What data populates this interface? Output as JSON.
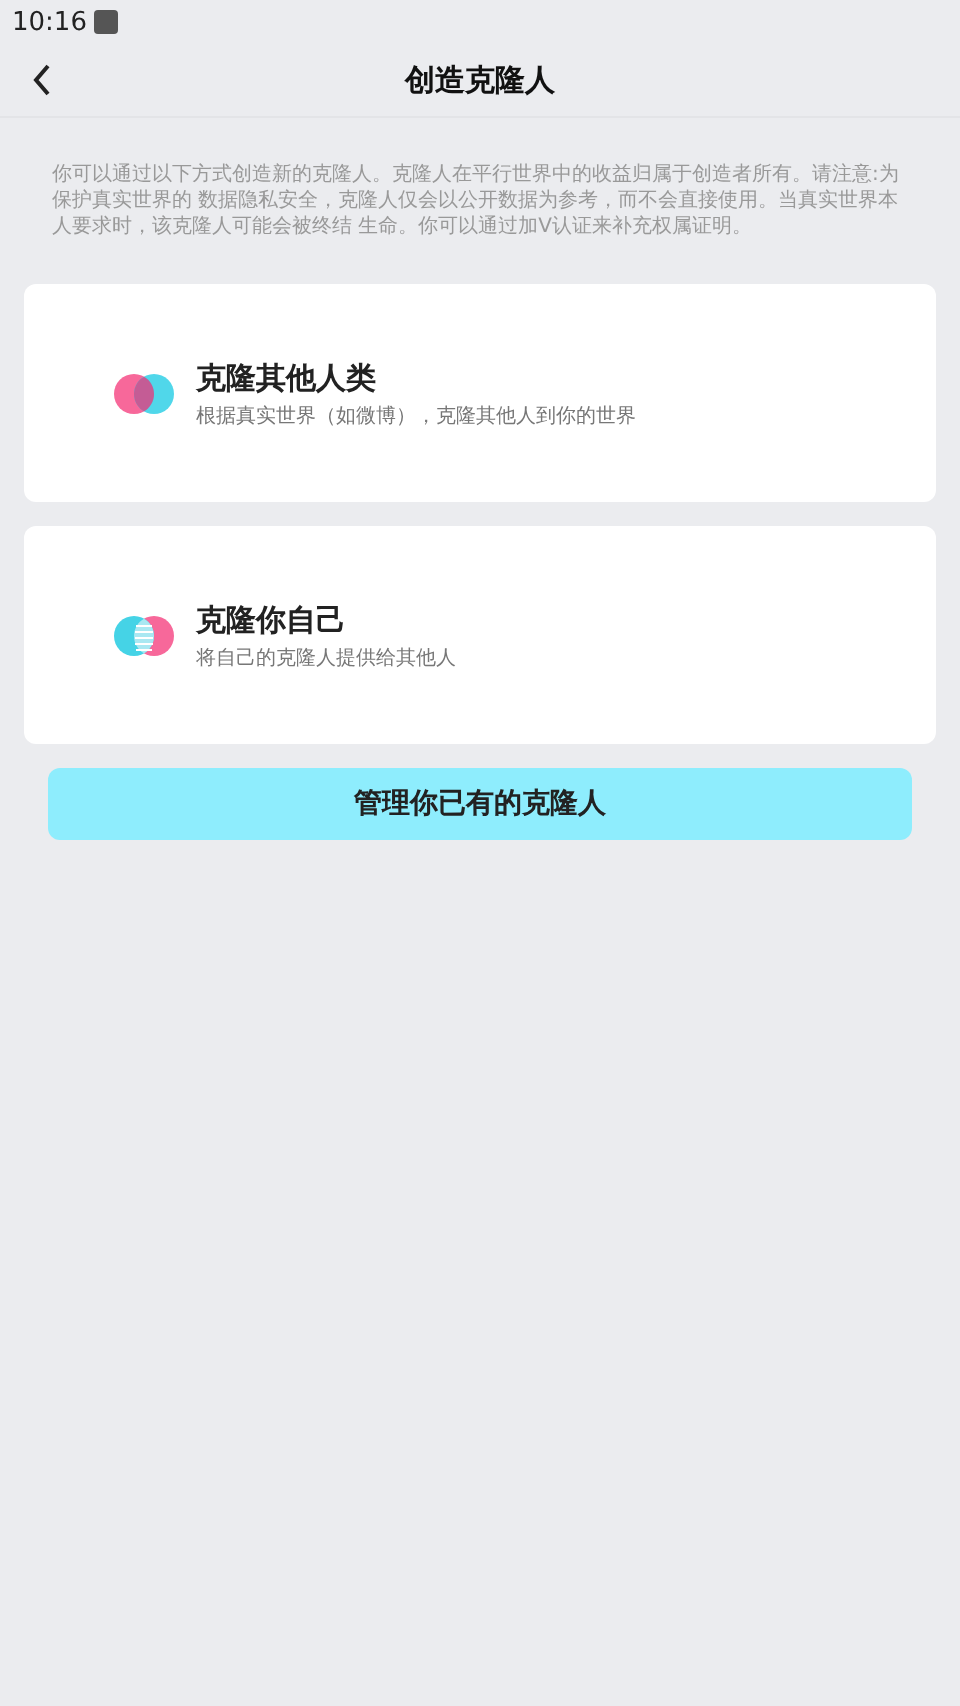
{
  "status_bar": {
    "time": "10:16"
  },
  "header": {
    "title": "创造克隆人"
  },
  "notice": "你可以通过以下方式创造新的克隆人。克隆人在平行世界中的收益归属于创造者所有。请注意:为保护真实世界的 数据隐私安全，克隆人仅会以公开数据为参考，而不会直接使用。当真实世界本人要求时，该克隆人可能会被终结 生命。你可以通过加V认证来补充权属证明。",
  "options": [
    {
      "kind": "others",
      "title": "克隆其他人类",
      "subtitle": "根据真实世界（如微博），克隆其他人到你的世界"
    },
    {
      "kind": "self",
      "title": "克隆你自己",
      "subtitle": "将自己的克隆人提供给其他人"
    }
  ],
  "manage_button": "管理你已有的克隆人"
}
